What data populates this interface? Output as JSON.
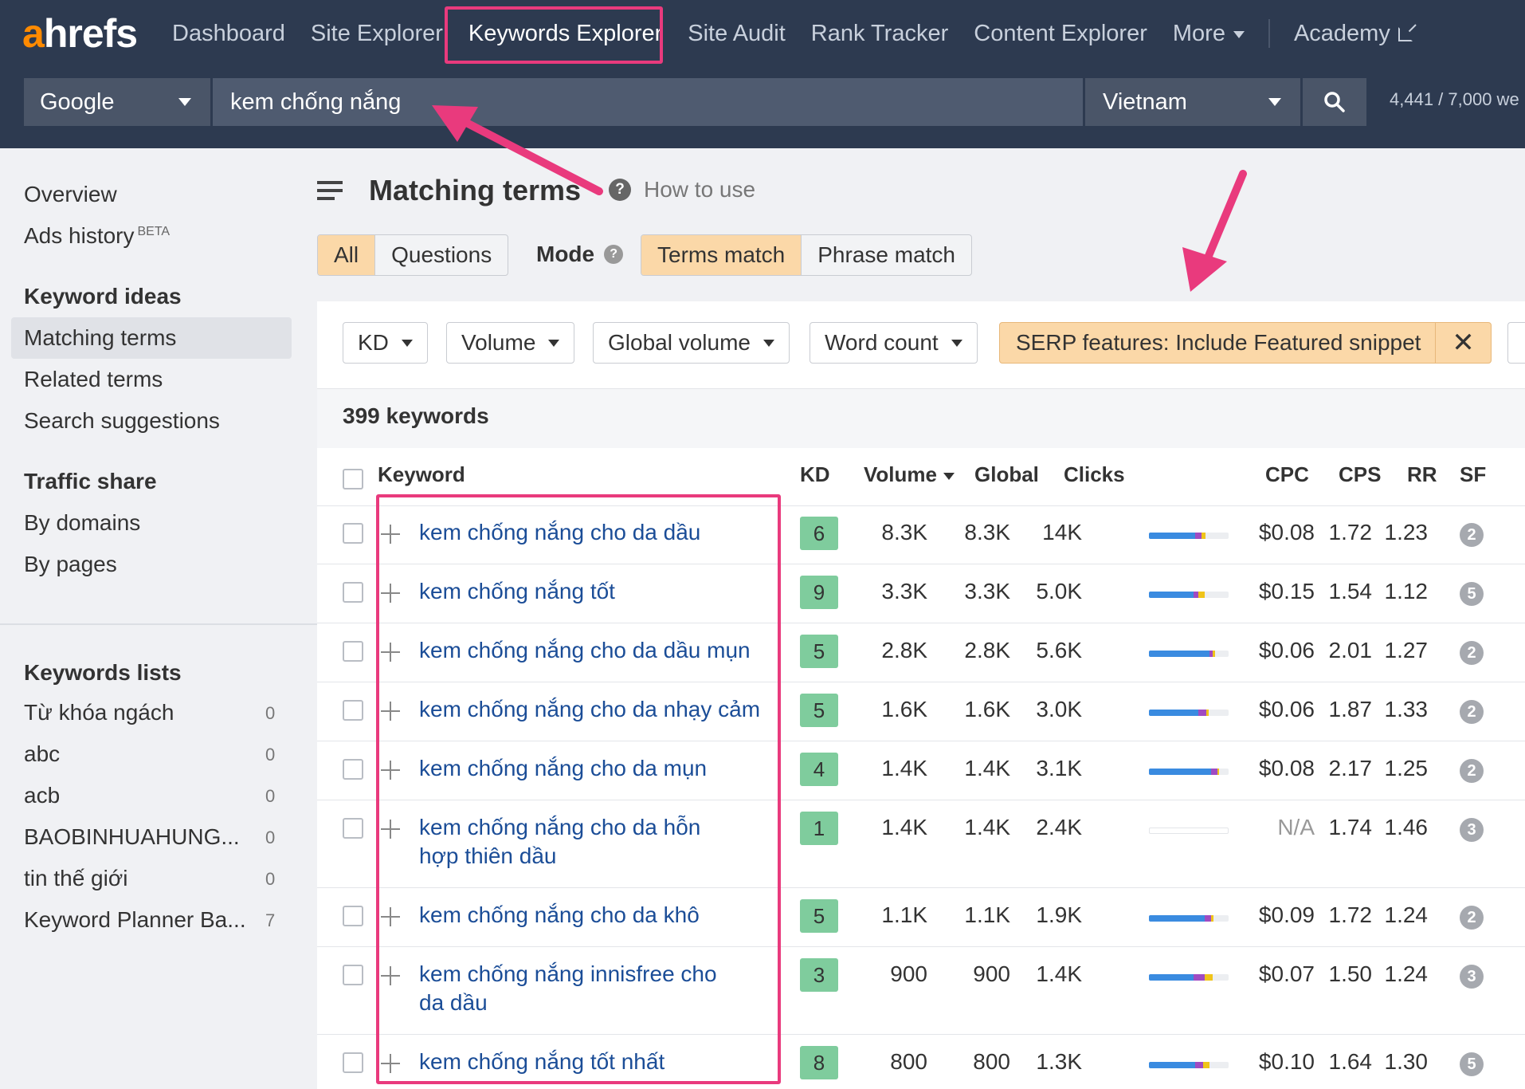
{
  "header": {
    "logo_a": "a",
    "logo_rest": "hrefs",
    "nav": [
      {
        "label": "Dashboard"
      },
      {
        "label": "Site Explorer"
      },
      {
        "label": "Keywords Explorer"
      },
      {
        "label": "Site Audit"
      },
      {
        "label": "Rank Tracker"
      },
      {
        "label": "Content Explorer"
      },
      {
        "label": "More"
      }
    ],
    "academy": "Academy",
    "active_nav": "Keywords Explorer",
    "engine": "Google",
    "query": "kem chống nắng",
    "country": "Vietnam",
    "credits": "4,441 / 7,000 we"
  },
  "sidebar": {
    "overview": "Overview",
    "ads_history": "Ads history",
    "beta": "BETA",
    "keyword_ideas": "Keyword ideas",
    "matching_terms": "Matching terms",
    "related_terms": "Related terms",
    "search_suggestions": "Search suggestions",
    "traffic_share": "Traffic share",
    "by_domains": "By domains",
    "by_pages": "By pages",
    "keywords_lists": "Keywords lists",
    "lists": [
      {
        "name": "Từ khóa ngách",
        "count": "0"
      },
      {
        "name": "abc",
        "count": "0"
      },
      {
        "name": "acb",
        "count": "0"
      },
      {
        "name": "BAOBINHUAHUNG...",
        "count": "0"
      },
      {
        "name": "tin thế giới",
        "count": "0"
      },
      {
        "name": "Keyword Planner Ba...",
        "count": "7"
      }
    ]
  },
  "main": {
    "title": "Matching terms",
    "how_to_use": "How to use",
    "tab_all": "All",
    "tab_questions": "Questions",
    "mode_label": "Mode",
    "mode_terms": "Terms match",
    "mode_phrase": "Phrase match",
    "filters": {
      "kd": "KD",
      "volume": "Volume",
      "global_volume": "Global volume",
      "word_count": "Word count",
      "serp": "SERP features: Include Featured snippet"
    },
    "count": "399 keywords",
    "columns": {
      "keyword": "Keyword",
      "kd": "KD",
      "volume": "Volume",
      "global": "Global",
      "clicks": "Clicks",
      "cpc": "CPC",
      "cps": "CPS",
      "rr": "RR",
      "sf": "SF"
    },
    "rows": [
      {
        "keyword": "kem chống nắng cho da dầu",
        "kd": "6",
        "volume": "8.3K",
        "global": "8.3K",
        "clicks": "14K",
        "cpc": "$0.08",
        "cps": "1.72",
        "rr": "1.23",
        "sf": "2"
      },
      {
        "keyword": "kem chống nắng tốt",
        "kd": "9",
        "volume": "3.3K",
        "global": "3.3K",
        "clicks": "5.0K",
        "cpc": "$0.15",
        "cps": "1.54",
        "rr": "1.12",
        "sf": "5"
      },
      {
        "keyword": "kem chống nắng cho da dầu mụn",
        "kd": "5",
        "volume": "2.8K",
        "global": "2.8K",
        "clicks": "5.6K",
        "cpc": "$0.06",
        "cps": "2.01",
        "rr": "1.27",
        "sf": "2"
      },
      {
        "keyword": "kem chống nắng cho da nhạy cảm",
        "kd": "5",
        "volume": "1.6K",
        "global": "1.6K",
        "clicks": "3.0K",
        "cpc": "$0.06",
        "cps": "1.87",
        "rr": "1.33",
        "sf": "2"
      },
      {
        "keyword": "kem chống nắng cho da mụn",
        "kd": "4",
        "volume": "1.4K",
        "global": "1.4K",
        "clicks": "3.1K",
        "cpc": "$0.08",
        "cps": "2.17",
        "rr": "1.25",
        "sf": "2"
      },
      {
        "keyword": "kem chống nắng cho da hỗn hợp thiên dầu",
        "kd": "1",
        "volume": "1.4K",
        "global": "1.4K",
        "clicks": "2.4K",
        "cpc": "N/A",
        "cps": "1.74",
        "rr": "1.46",
        "sf": "3"
      },
      {
        "keyword": "kem chống nắng cho da khô",
        "kd": "5",
        "volume": "1.1K",
        "global": "1.1K",
        "clicks": "1.9K",
        "cpc": "$0.09",
        "cps": "1.72",
        "rr": "1.24",
        "sf": "2"
      },
      {
        "keyword": "kem chống nắng innisfree cho da dầu",
        "kd": "3",
        "volume": "900",
        "global": "900",
        "clicks": "1.4K",
        "cpc": "$0.07",
        "cps": "1.50",
        "rr": "1.24",
        "sf": "3"
      },
      {
        "keyword": "kem chống nắng tốt nhất",
        "kd": "8",
        "volume": "800",
        "global": "800",
        "clicks": "1.3K",
        "cpc": "$0.10",
        "cps": "1.64",
        "rr": "1.30",
        "sf": "5"
      }
    ]
  },
  "colors": {
    "header_bg": "#2d3a50",
    "logo_accent": "#ff8a00",
    "highlight": "#e93a7d",
    "active_toggle": "#fbd8a8",
    "kd_green": "#7fcc9d",
    "link_blue": "#1b4d97"
  }
}
